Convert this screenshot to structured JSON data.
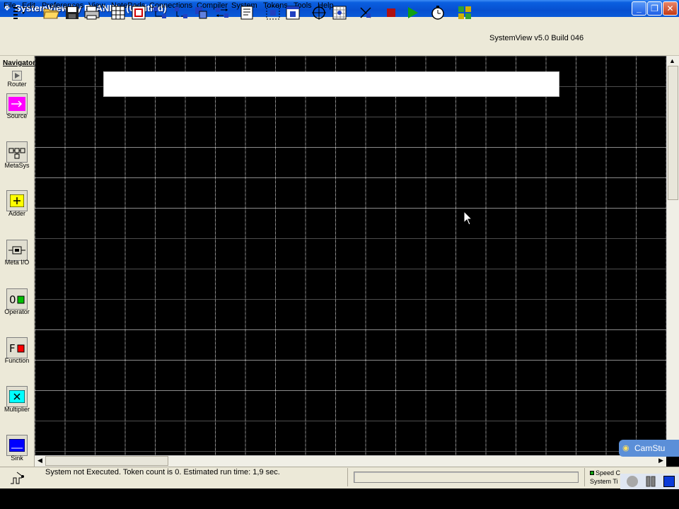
{
  "window": {
    "title": "SystemView by ELANIX - (Untitled)",
    "title_bar_color": "#0a5fe0"
  },
  "menu": [
    "File",
    "Edit",
    "Preferences",
    "View",
    "NotePads",
    "Connections",
    "Compiler",
    "System",
    "Tokens",
    "Tools",
    "Help"
  ],
  "toolbar": {
    "version": "SystemView v5.0 Build 046",
    "buttons": [
      "token-list-icon",
      "open-folder-icon",
      "save-disk-icon",
      "print-icon",
      "grid-icon",
      "delete-token-icon",
      "connect-icon",
      "disconnect-icon",
      "duplicate-icon",
      "reverse-icon",
      "notepad-icon",
      "create-metasystem-icon",
      "view-metasystem-icon",
      "root-locus-icon",
      "bode-icon",
      "cancel-icon",
      "stop-icon",
      "run-icon",
      "timing-icon",
      "analysis-window-icon"
    ]
  },
  "navigator": {
    "title": "Navigator",
    "tokens": [
      {
        "label": "Router",
        "icon": "router-icon",
        "color": "#808080"
      },
      {
        "label": "Source",
        "icon": "source-icon",
        "color": "#ff00ff"
      },
      {
        "label": "MetaSys",
        "icon": "metasys-icon",
        "color": "#e0ded0"
      },
      {
        "label": "Adder",
        "icon": "adder-icon",
        "color": "#ffff00"
      },
      {
        "label": "Meta I/O",
        "icon": "meta-io-icon",
        "color": "#e0ded0"
      },
      {
        "label": "Operator",
        "icon": "operator-icon",
        "color": "#00c000"
      },
      {
        "label": "Function",
        "icon": "function-icon",
        "color": "#ff0000"
      },
      {
        "label": "Multiplier",
        "icon": "multiplier-icon",
        "color": "#00ffff"
      },
      {
        "label": "Sink",
        "icon": "sink-icon",
        "color": "#0000ff"
      }
    ]
  },
  "status": {
    "message": "System not Executed. Token count is 0.  Estimated run time: 1,9 sec.",
    "speed_label": "Speed C",
    "system_time_label": "System Ti"
  },
  "overlay": {
    "camstudio_label": "CamStu"
  }
}
